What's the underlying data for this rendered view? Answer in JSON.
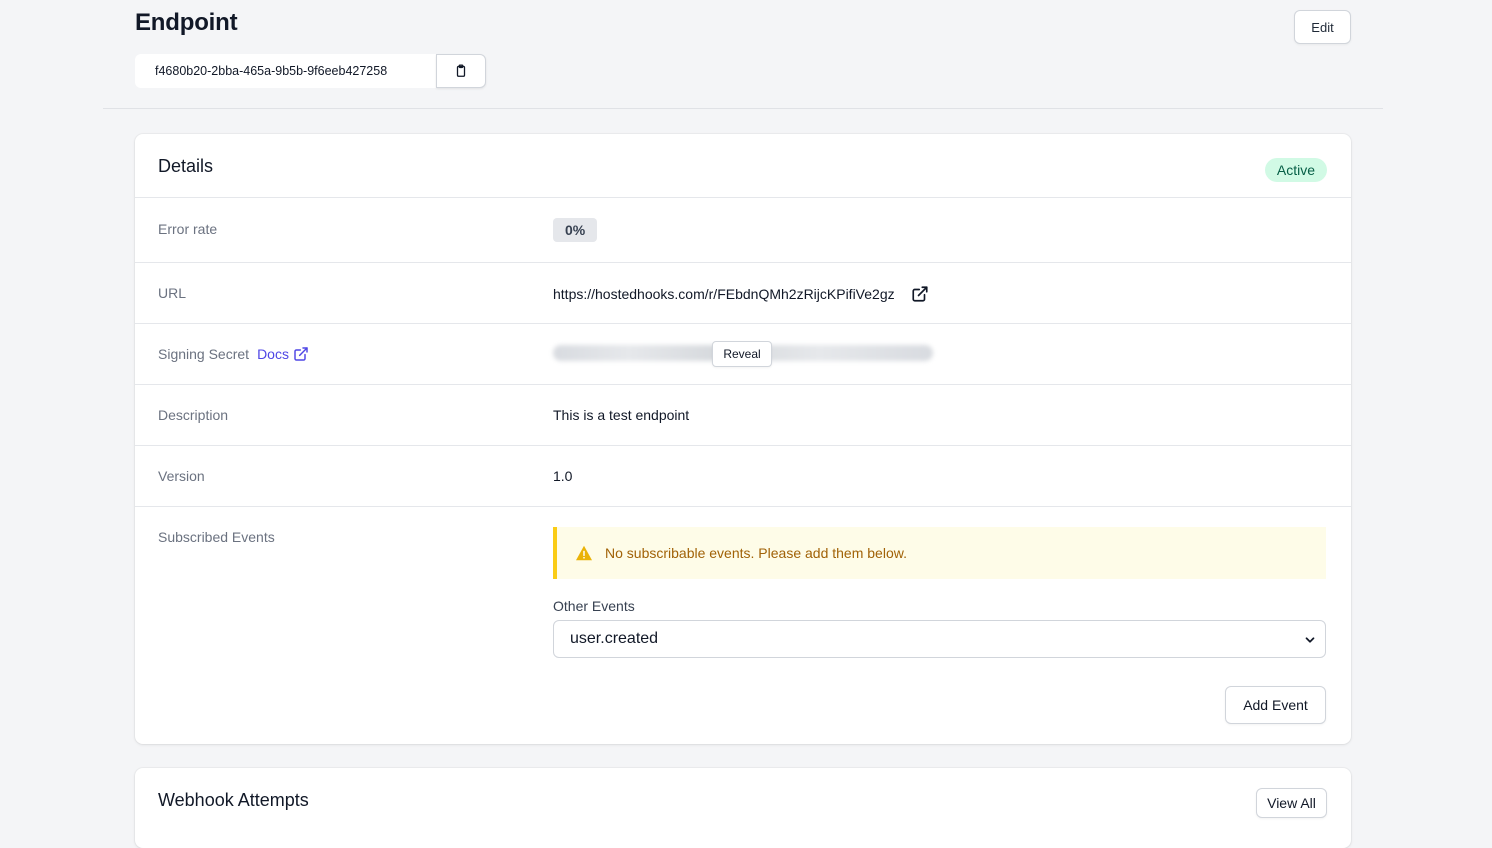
{
  "header": {
    "title": "Endpoint",
    "edit_label": "Edit",
    "endpoint_id": "f4680b20-2bba-465a-9b5b-9f6eeb427258"
  },
  "details": {
    "title": "Details",
    "status": "Active",
    "rows": {
      "error_rate": {
        "label": "Error rate",
        "value": "0%"
      },
      "url": {
        "label": "URL",
        "value": "https://hostedhooks.com/r/FEbdnQMh2zRijcKPifiVe2gz"
      },
      "signing_secret": {
        "label": "Signing Secret",
        "docs_label": "Docs",
        "reveal_label": "Reveal"
      },
      "description": {
        "label": "Description",
        "value": "This is a test endpoint"
      },
      "version": {
        "label": "Version",
        "value": "1.0"
      },
      "subscribed_events": {
        "label": "Subscribed Events",
        "alert": "No subscribable events. Please add them below.",
        "other_events_label": "Other Events",
        "selected_event": "user.created",
        "add_event_label": "Add Event"
      }
    }
  },
  "attempts": {
    "title": "Webhook Attempts",
    "view_all_label": "View All"
  },
  "colors": {
    "background": "#f4f5f7",
    "status_active_bg": "#d1fae5",
    "status_active_text": "#065f46",
    "link": "#4f46e5",
    "alert_bg": "#fefce8",
    "alert_border": "#facc15",
    "alert_text": "#a16207"
  }
}
